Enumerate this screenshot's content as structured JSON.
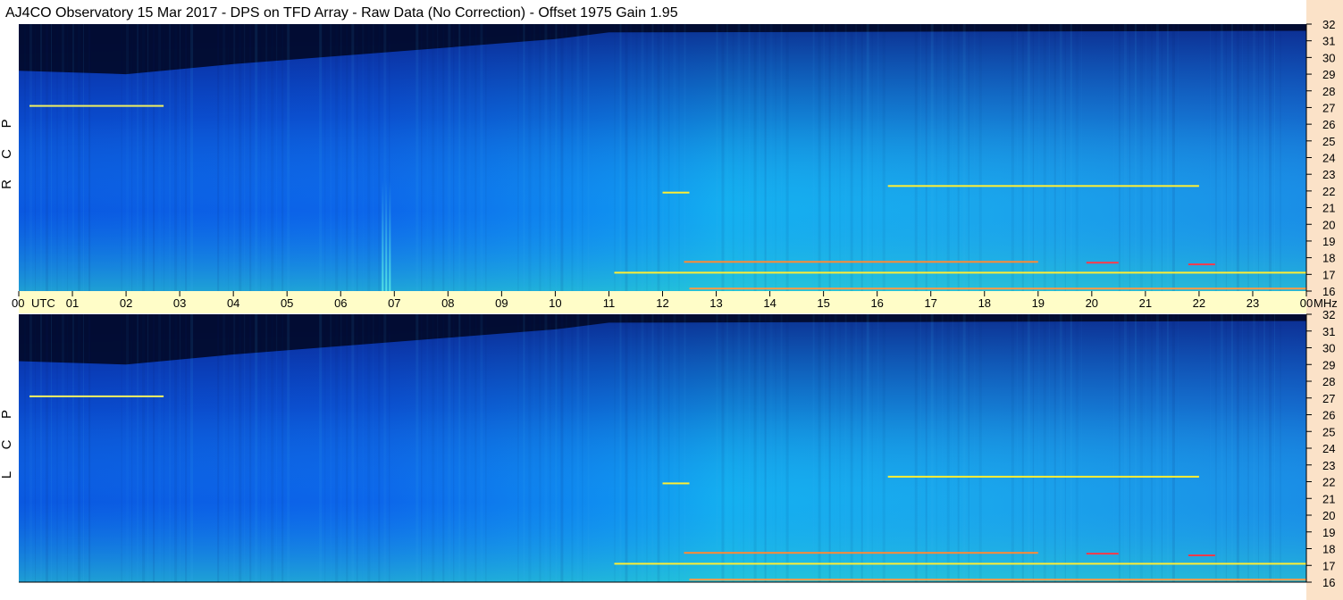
{
  "chart_data": {
    "type": "heatmap",
    "title": "AJ4CO Observatory  15 Mar 2017  -  DPS on TFD Array  -  Raw Data (No Correction)  -  Offset 1975  Gain 1.95",
    "x_unit_label": "UTC",
    "y_unit_label": "MHz",
    "x_ticks": [
      "00",
      "01",
      "02",
      "03",
      "04",
      "05",
      "06",
      "07",
      "08",
      "09",
      "10",
      "11",
      "12",
      "13",
      "14",
      "15",
      "16",
      "17",
      "18",
      "19",
      "20",
      "21",
      "22",
      "23",
      "00"
    ],
    "xlim": [
      0,
      24
    ],
    "y_ticks": [
      16,
      17,
      18,
      19,
      20,
      21,
      22,
      23,
      24,
      25,
      26,
      27,
      28,
      29,
      30,
      31,
      32
    ],
    "ylim": [
      16,
      32
    ],
    "panels": [
      {
        "label": [
          "R",
          "C",
          "P"
        ]
      },
      {
        "label": [
          "L",
          "C",
          "P"
        ]
      }
    ],
    "features": {
      "dark_band_top_mhz_start_curve": [
        [
          0,
          29.2
        ],
        [
          2,
          29.0
        ],
        [
          4,
          29.6
        ],
        [
          6,
          30.1
        ],
        [
          8,
          30.6
        ],
        [
          10,
          31.1
        ],
        [
          11,
          31.5
        ],
        [
          24,
          31.6
        ]
      ],
      "interference_lines": [
        {
          "mhz": 17.1,
          "utc_start": 11.1,
          "utc_end": 24.0,
          "color": "#ffee33"
        },
        {
          "mhz": 17.75,
          "utc_start": 12.4,
          "utc_end": 19.0,
          "color": "#ff8a33"
        },
        {
          "mhz": 17.7,
          "utc_start": 19.9,
          "utc_end": 20.5,
          "color": "#ff3a4a"
        },
        {
          "mhz": 17.6,
          "utc_start": 21.8,
          "utc_end": 22.3,
          "color": "#ff3a4a"
        },
        {
          "mhz": 16.15,
          "utc_start": 12.5,
          "utc_end": 24.0,
          "color": "#ff9a44"
        },
        {
          "mhz": 22.3,
          "utc_start": 16.2,
          "utc_end": 22.0,
          "color": "#ffee33"
        },
        {
          "mhz": 21.9,
          "utc_start": 12.0,
          "utc_end": 12.5,
          "color": "#ffee33"
        },
        {
          "mhz": 27.1,
          "utc_start": 0.2,
          "utc_end": 2.7,
          "color": "#f0f060"
        }
      ],
      "burst_utc": 6.9
    }
  }
}
